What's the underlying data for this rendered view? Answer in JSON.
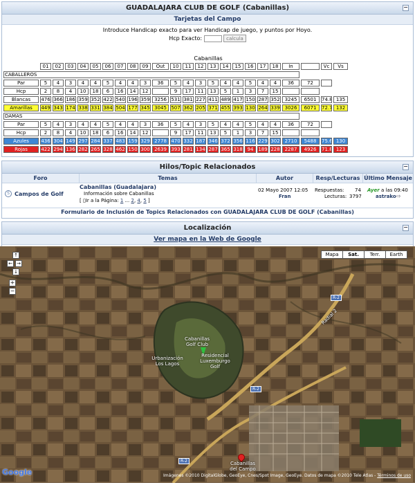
{
  "scorecard_panel": {
    "title": "GUADALAJARA CLUB DE GOLF (Cabanillas)",
    "subtitle": "Tarjetas del Campo",
    "intro": "Introduce Handicap exacto para ver Handicap de juego, y puntos por Hoyo.",
    "hcp_label": "Hcp Exacto:",
    "hcp_value": "",
    "calc_button": "calcula",
    "course_name": "Cabanillas",
    "holes_front": [
      "01",
      "02",
      "03",
      "04",
      "05",
      "06",
      "07",
      "08",
      "09"
    ],
    "out_label": "Out",
    "holes_back": [
      "10",
      "11",
      "12",
      "13",
      "14",
      "15",
      "16",
      "17",
      "18"
    ],
    "in_label": "In",
    "vc_label": "Vc",
    "vs_label": "Vs",
    "men": {
      "section": "CABALLEROS",
      "par": {
        "label": "Par",
        "front": [
          "5",
          "4",
          "3",
          "4",
          "4",
          "5",
          "4",
          "4",
          "3"
        ],
        "out": "36",
        "back": [
          "5",
          "4",
          "3",
          "5",
          "4",
          "4",
          "5",
          "4",
          "4"
        ],
        "in": "36",
        "total": "72"
      },
      "hcp": {
        "label": "Hcp",
        "front": [
          "2",
          "8",
          "4",
          "10",
          "18",
          "6",
          "16",
          "14",
          "12"
        ],
        "back": [
          "9",
          "17",
          "11",
          "13",
          "5",
          "1",
          "3",
          "7",
          "15"
        ]
      },
      "tees": [
        {
          "label": "Blancas",
          "front": [
            "476",
            "366",
            "186",
            "359",
            "352",
            "422",
            "540",
            "196",
            "359"
          ],
          "out": "3256",
          "back": [
            "531",
            "381",
            "227",
            "411",
            "489",
            "417",
            "150",
            "287",
            "352"
          ],
          "in": "3245",
          "total": "6501",
          "vc": "74.8",
          "vs": "135",
          "color": "#ffffff",
          "text": "#000000"
        },
        {
          "label": "Amarillas",
          "front": [
            "449",
            "343",
            "174",
            "338",
            "331",
            "384",
            "504",
            "177",
            "345"
          ],
          "out": "3045",
          "back": [
            "507",
            "362",
            "205",
            "371",
            "455",
            "393",
            "130",
            "264",
            "339"
          ],
          "in": "3026",
          "total": "6071",
          "vc": "72.7",
          "vs": "132",
          "color": "#ffff33",
          "text": "#000000"
        }
      ]
    },
    "women": {
      "section": "DAMAS",
      "par": {
        "label": "Par",
        "front": [
          "5",
          "4",
          "3",
          "4",
          "4",
          "5",
          "4",
          "4",
          "3"
        ],
        "out": "36",
        "back": [
          "5",
          "4",
          "3",
          "5",
          "4",
          "4",
          "5",
          "4",
          "4"
        ],
        "in": "36",
        "total": "72"
      },
      "hcp": {
        "label": "Hcp",
        "front": [
          "2",
          "8",
          "4",
          "10",
          "18",
          "6",
          "16",
          "14",
          "12"
        ],
        "back": [
          "9",
          "17",
          "11",
          "13",
          "5",
          "1",
          "3",
          "7",
          "15"
        ]
      },
      "tees": [
        {
          "label": "Azules",
          "front": [
            "436",
            "304",
            "149",
            "297",
            "284",
            "337",
            "483",
            "159",
            "329"
          ],
          "out": "2778",
          "back": [
            "470",
            "332",
            "187",
            "346",
            "372",
            "356",
            "116",
            "229",
            "302"
          ],
          "in": "2710",
          "total": "5488",
          "vc": "75.6",
          "vs": "130",
          "color": "#3d86d4",
          "text": "#ffffff"
        },
        {
          "label": "Rojas",
          "front": [
            "422",
            "294",
            "136",
            "282",
            "265",
            "328",
            "462",
            "150",
            "300"
          ],
          "out": "2639",
          "back": [
            "393",
            "281",
            "134",
            "287",
            "365",
            "318",
            "94",
            "189",
            "228"
          ],
          "in": "2287",
          "total": "4926",
          "vc": "71.8",
          "vs": "123",
          "color": "#e02222",
          "text": "#ffffff"
        }
      ]
    }
  },
  "topics_panel": {
    "title": "Hilos/Topic Relacionados",
    "columns": [
      "Foro",
      "Temas",
      "Autor",
      "Resp/Lecturas",
      "Último Mensaje"
    ],
    "row": {
      "forum": "Campos de Golf",
      "topic_title": "Cabanillas (Guadalajara)",
      "topic_desc": "Información sobre Cabanillas",
      "goto_prefix": "[ ",
      "goto_label": "Ir a la Página:",
      "pages": [
        "1",
        "2",
        "4",
        "5"
      ],
      "date": "02 Mayo 2007 12:05",
      "author": "Fran",
      "replies_label": "Respuestas:",
      "replies": "74",
      "reads_label": "Lecturas:",
      "reads": "3797",
      "last_day": "Ayer",
      "last_time": "a las 09:40",
      "last_user": "astrako"
    },
    "footer": "Formulario de Inclusión de Topics Relacionados con GUADALAJARA CLUB DE GOLF (Cabanillas)"
  },
  "map_panel": {
    "title": "Localización",
    "link": "Ver mapa en la Web de Google",
    "types": [
      "Mapa",
      "Sat.",
      "Terr.",
      "Earth"
    ],
    "selected_type": "Sat.",
    "labels": {
      "golf": "Cabanillas Golf Club",
      "residencial": "Residencial Luxemburgo Golf",
      "urbanizacion": "Urbanización Los Lagos",
      "town": "Cabanillas del Campo",
      "r2a": "R-2",
      "r2b": "R-2",
      "r2c": "R-2",
      "radial": "Radial 2"
    },
    "attribution": "Imágenes ©2010 DigitalGlobe, GeoEye, Cnes/Spot Image, GeoEye. Datos de mapa ©2010 Tele Atlas -",
    "terms": "Términos de uso",
    "logo": "Google"
  },
  "colors": {
    "header_bg": "#c9d8ea",
    "link": "#223a66",
    "yellow": "#ffff33",
    "blue": "#3d86d4",
    "red": "#e02222"
  }
}
